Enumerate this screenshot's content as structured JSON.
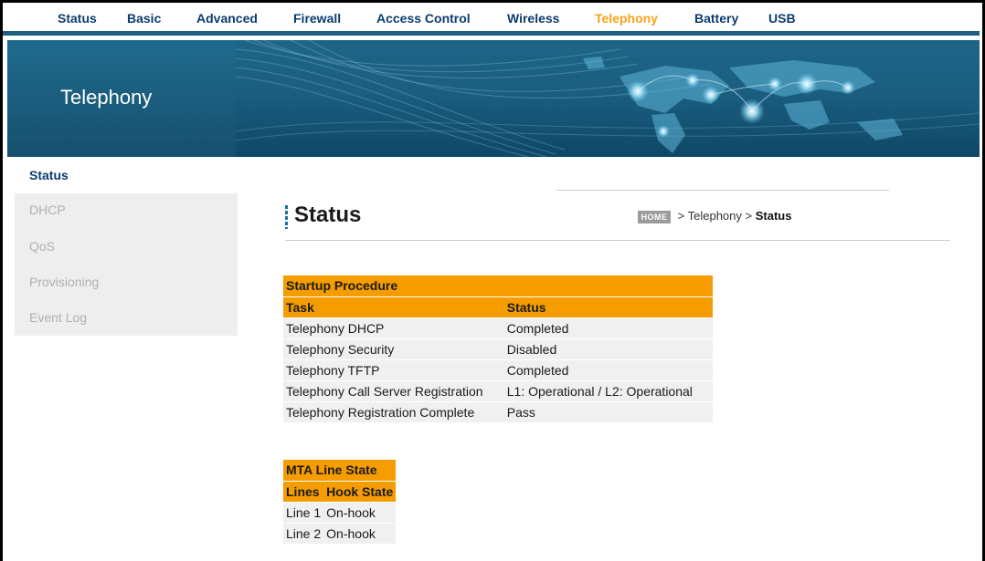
{
  "nav": {
    "items": [
      {
        "label": "Status",
        "active": false
      },
      {
        "label": "Basic",
        "active": false
      },
      {
        "label": "Advanced",
        "active": false
      },
      {
        "label": "Firewall",
        "active": false
      },
      {
        "label": "Access Control",
        "active": false
      },
      {
        "label": "Wireless",
        "active": false
      },
      {
        "label": "Telephony",
        "active": true
      },
      {
        "label": "Battery",
        "active": false
      },
      {
        "label": "USB",
        "active": false
      }
    ]
  },
  "banner": {
    "title": "Telephony"
  },
  "side": {
    "items": [
      {
        "label": "Status",
        "active": true
      },
      {
        "label": "DHCP",
        "active": false
      },
      {
        "label": "QoS",
        "active": false
      },
      {
        "label": "Provisioning",
        "active": false
      },
      {
        "label": "Event Log",
        "active": false
      }
    ]
  },
  "main": {
    "title": "Status",
    "breadcrumb": {
      "home": "HOME",
      "sep1": ">",
      "section": "Telephony",
      "sep2": ">",
      "current": "Status"
    }
  },
  "startup": {
    "caption": "Startup Procedure",
    "headers": [
      "Task",
      "Status"
    ],
    "rows": [
      [
        "Telephony DHCP",
        "Completed"
      ],
      [
        "Telephony Security",
        "Disabled"
      ],
      [
        "Telephony TFTP",
        "Completed"
      ],
      [
        "Telephony Call Server Registration",
        "L1: Operational / L2: Operational"
      ],
      [
        "Telephony Registration Complete",
        "Pass"
      ]
    ]
  },
  "mta": {
    "caption": "MTA Line State",
    "headers": [
      "Lines",
      "Hook State"
    ],
    "rows": [
      [
        "Line 1",
        "On-hook"
      ],
      [
        "Line 2",
        "On-hook"
      ]
    ]
  },
  "colors": {
    "nav_text": "#0b3c6e",
    "nav_active": "#f6a21a",
    "table_header": "#f59d00",
    "banner": "#1a5e80"
  }
}
